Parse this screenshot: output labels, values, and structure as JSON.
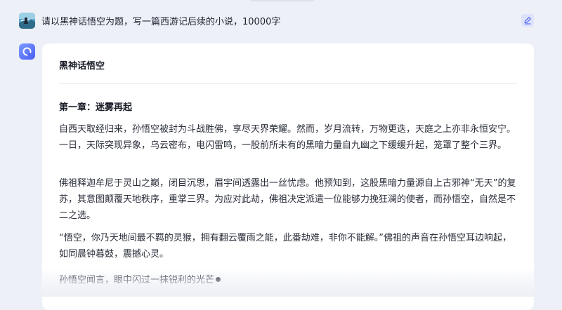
{
  "user_message": {
    "avatar": "landscape-avatar-icon",
    "text": "请以黑神话悟空为题，写一篇西游记后续的小说，10000字",
    "edit_icon": "pencil-icon"
  },
  "assistant": {
    "avatar": "assistant-logo-icon",
    "doc_title": "黑神话悟空",
    "chapter_title": "第一章：迷雾再起",
    "paragraphs": [
      "自西天取经归来，孙悟空被封为斗战胜佛，享尽天界荣耀。然而，岁月流转，万物更迭，天庭之上亦非永恒安宁。一日，天际突现异象，乌云密布，电闪雷鸣，一股前所未有的黑暗力量自九幽之下缓缓升起，笼罩了整个三界。",
      "佛祖释迦牟尼于灵山之巅，闭目沉思，眉宇间透露出一丝忧虑。他预知到，这股黑暗力量源自上古邪神“无天”的复苏，其意图颠覆天地秩序，重掌三界。为应对此劫，佛祖决定派遣一位能够力挽狂澜的使者，而孙悟空，自然是不二之选。",
      "“悟空，你乃天地间最不羁的灵猴，拥有翻云覆雨之能，此番劫难，非你不能解。”佛祖的声音在孙悟空耳边响起，如同晨钟暮鼓，震撼心灵。",
      "孙悟空闻言，眼中闪过一抹锐利的光芒"
    ]
  },
  "colors": {
    "background": "#eef0f7",
    "card": "#ffffff",
    "accent": "#4b5ef5",
    "edit_button_bg": "#dde2fb"
  }
}
